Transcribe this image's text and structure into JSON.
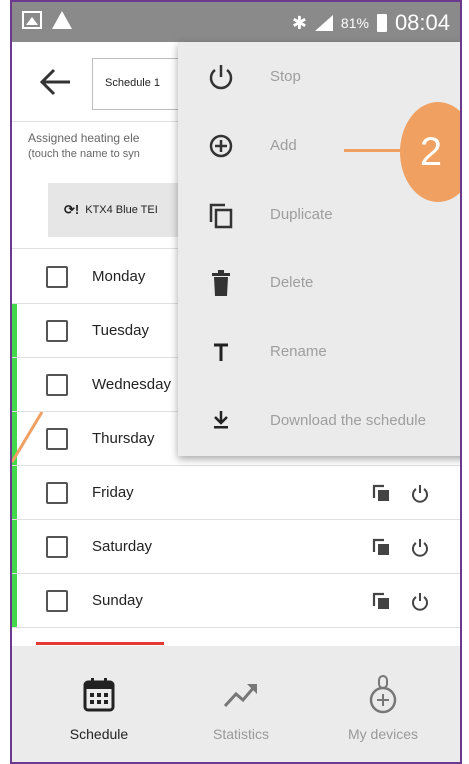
{
  "status_bar": {
    "battery": "81%",
    "time": "08:04"
  },
  "header": {
    "schedule_name": "Schedule 1"
  },
  "assigned": {
    "line1": "Assigned heating ele",
    "line2": "(touch the name to syn",
    "device_name": "KTX4 Blue TEI",
    "device_icon_text": "⟳!"
  },
  "days": [
    {
      "label": "Monday",
      "active": false,
      "show_actions": false
    },
    {
      "label": "Tuesday",
      "active": true,
      "show_actions": false
    },
    {
      "label": "Wednesday",
      "active": true,
      "show_actions": false
    },
    {
      "label": "Thursday",
      "active": true,
      "show_actions": false
    },
    {
      "label": "Friday",
      "active": true,
      "show_actions": true
    },
    {
      "label": "Saturday",
      "active": true,
      "show_actions": true
    },
    {
      "label": "Sunday",
      "active": true,
      "show_actions": true
    }
  ],
  "menu": {
    "items": [
      {
        "label": "Stop",
        "icon": "power-icon"
      },
      {
        "label": "Add",
        "icon": "add-circle-icon"
      },
      {
        "label": "Duplicate",
        "icon": "copy-icon"
      },
      {
        "label": "Delete",
        "icon": "trash-icon"
      },
      {
        "label": "Rename",
        "icon": "text-icon"
      },
      {
        "label": "Download the schedule",
        "icon": "download-icon"
      }
    ]
  },
  "annotation": {
    "number": "2",
    "color": "#f0a060"
  },
  "bottom_nav": {
    "items": [
      {
        "label": "Schedule",
        "icon": "calendar-icon",
        "active": true
      },
      {
        "label": "Statistics",
        "icon": "trend-icon",
        "active": false
      },
      {
        "label": "My devices",
        "icon": "thermostat-icon",
        "active": false
      }
    ]
  },
  "colors": {
    "active_day": "#41d94b",
    "tab_indicator": "#e53935",
    "frame": "#6b3a8e"
  }
}
